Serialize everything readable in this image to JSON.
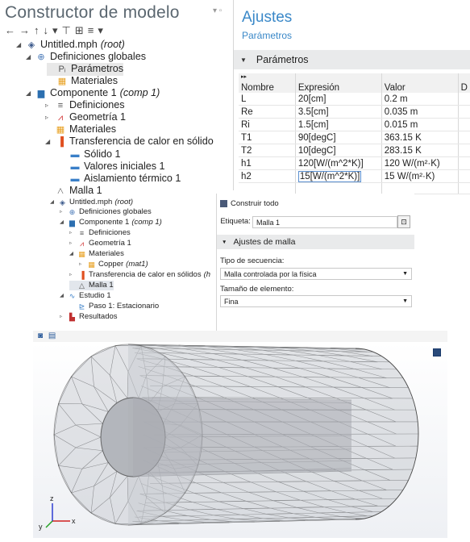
{
  "panel1": {
    "title": "Constructor de modelo",
    "tree": [
      {
        "label": "Untitled.mph",
        "suffix": "(root)",
        "icon": "model-root-icon",
        "glyph": "◈",
        "color": "#3c5a8c",
        "twisty": "◢"
      },
      {
        "label": "Definiciones globales",
        "icon": "global-definitions-icon",
        "glyph": "⊕",
        "color": "#4a7ab8",
        "twisty": "◢"
      },
      {
        "label": "Parámetros",
        "icon": "parameters-icon",
        "glyph": "Pᵢ",
        "color": "#555",
        "twisty": ""
      },
      {
        "label": "Materiales",
        "icon": "materials-icon",
        "glyph": "▦",
        "color": "#e8a020",
        "twisty": ""
      },
      {
        "label": "Componente 1",
        "suffix": "(comp 1)",
        "icon": "component-icon",
        "glyph": "▆",
        "color": "#2c6fb0",
        "twisty": "◢"
      },
      {
        "label": "Definiciones",
        "icon": "definitions-icon",
        "glyph": "≡",
        "color": "#555",
        "twisty": "▹"
      },
      {
        "label": "Geometría 1",
        "icon": "geometry-icon",
        "glyph": "⩘",
        "color": "#d03030",
        "twisty": "▹"
      },
      {
        "label": "Materiales",
        "icon": "materials-icon",
        "glyph": "▦",
        "color": "#e8a020",
        "twisty": ""
      },
      {
        "label": "Transferencia de calor en sólido",
        "icon": "heat-transfer-icon",
        "glyph": "▐",
        "color": "#e05020",
        "twisty": "◢"
      },
      {
        "label": "Sólido 1",
        "icon": "solid-icon",
        "glyph": "▬",
        "color": "#3a7fc8",
        "twisty": ""
      },
      {
        "label": "Valores iniciales 1",
        "icon": "initial-values-icon",
        "glyph": "▬",
        "color": "#3a7fc8",
        "twisty": ""
      },
      {
        "label": "Aislamiento térmico 1",
        "icon": "thermal-insulation-icon",
        "glyph": "▬",
        "color": "#3a7fc8",
        "twisty": ""
      },
      {
        "label": "Malla 1",
        "icon": "mesh-icon",
        "glyph": "△",
        "color": "#555",
        "twisty": ""
      }
    ],
    "settings": {
      "title": "Ajustes",
      "subtitle": "Parámetros",
      "section": "Parámetros",
      "columns": [
        "Nombre",
        "Expresión",
        "Valor",
        "D"
      ],
      "rows": [
        [
          "L",
          "20[cm]",
          "0.2 m"
        ],
        [
          "Re",
          "3.5[cm]",
          "0.035 m"
        ],
        [
          "Ri",
          "1.5[cm]",
          "0.015 m"
        ],
        [
          "T1",
          "90[degC]",
          "363.15 K"
        ],
        [
          "T2",
          "10[degC]",
          "283.15 K"
        ],
        [
          "h1",
          "120[W/(m^2*K)]",
          "120 W/(m²·K)"
        ],
        [
          "h2",
          "15[W/(m^2*K)]",
          "15 W/(m²·K)"
        ]
      ]
    }
  },
  "panel2": {
    "tree": [
      {
        "label": "Untitled.mph",
        "suffix": "(root)",
        "icon": "model-root-icon",
        "glyph": "◈",
        "color": "#3c5a8c",
        "twisty": "◢"
      },
      {
        "label": "Definiciones globales",
        "icon": "global-definitions-icon",
        "glyph": "⊕",
        "color": "#4a7ab8",
        "twisty": "▹"
      },
      {
        "label": "Componente 1",
        "suffix": "(comp 1)",
        "icon": "component-icon",
        "glyph": "▆",
        "color": "#2c6fb0",
        "twisty": "◢"
      },
      {
        "label": "Definiciones",
        "icon": "definitions-icon",
        "glyph": "≡",
        "color": "#555",
        "twisty": "▹"
      },
      {
        "label": "Geometría 1",
        "icon": "geometry-icon",
        "glyph": "⩘",
        "color": "#d03030",
        "twisty": "▹"
      },
      {
        "label": "Materiales",
        "icon": "materials-icon",
        "glyph": "▦",
        "color": "#e8a020",
        "twisty": "◢"
      },
      {
        "label": "Copper",
        "suffix": "(mat1)",
        "icon": "material-icon",
        "glyph": "▦",
        "color": "#e8a020",
        "twisty": "▹"
      },
      {
        "label": "Transferencia de calor en sólidos",
        "suffix": "(h",
        "icon": "heat-transfer-icon",
        "glyph": "▐",
        "color": "#e05020",
        "twisty": "▹"
      },
      {
        "label": "Malla 1",
        "icon": "mesh-icon",
        "glyph": "△",
        "color": "#555",
        "twisty": ""
      },
      {
        "label": "Estudio 1",
        "icon": "study-icon",
        "glyph": "∿",
        "color": "#3a7fc8",
        "twisty": "◢"
      },
      {
        "label": "Paso 1: Estacionario",
        "icon": "study-step-icon",
        "glyph": "⊵",
        "color": "#3a7fc8",
        "twisty": ""
      },
      {
        "label": "Resultados",
        "icon": "results-icon",
        "glyph": "▙",
        "color": "#c03030",
        "twisty": "▹"
      }
    ],
    "settings": {
      "build_all": "Construir todo",
      "label_caption": "Etiqueta:",
      "label_value": "Malla 1",
      "section": "Ajustes de malla",
      "sequence_caption": "Tipo de secuencia:",
      "sequence_value": "Malla controlada por la física",
      "element_size_caption": "Tamaño de elemento:",
      "element_size_value": "Fina"
    }
  },
  "panel3": {
    "axis_x": "x",
    "axis_y": "y",
    "axis_z": "z",
    "colors": {
      "mesh_line": "#4a4a4a",
      "outer_fill": "#c9ccd2",
      "inner_fill": "#a9acb2",
      "axis_x": "#d02020",
      "axis_y": "#20a020",
      "axis_z": "#2030d0"
    }
  }
}
